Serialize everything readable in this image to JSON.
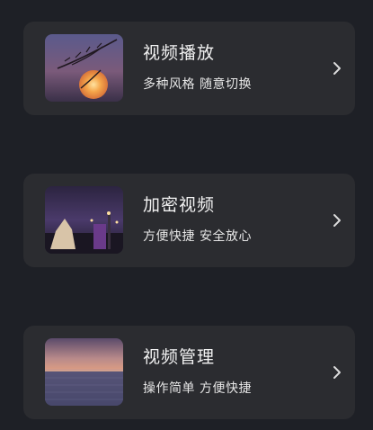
{
  "cards": [
    {
      "title": "视频播放",
      "subtitle": "多种风格 随意切换",
      "thumbnail": "sunset-grass-photo",
      "chevron_icon": "chevron-right-icon"
    },
    {
      "title": "加密视频",
      "subtitle": "方便快捷 安全放心",
      "thumbnail": "night-city-photo",
      "chevron_icon": "chevron-right-icon"
    },
    {
      "title": "视频管理",
      "subtitle": "操作简单 方便快捷",
      "thumbnail": "sea-sunset-photo",
      "chevron_icon": "chevron-right-icon"
    }
  ],
  "colors": {
    "background": "#1e2026",
    "card": "#2b2c30",
    "title_text": "#f2f2f2",
    "subtitle_text": "#e6e6e6",
    "chevron": "#dcdcdc"
  }
}
